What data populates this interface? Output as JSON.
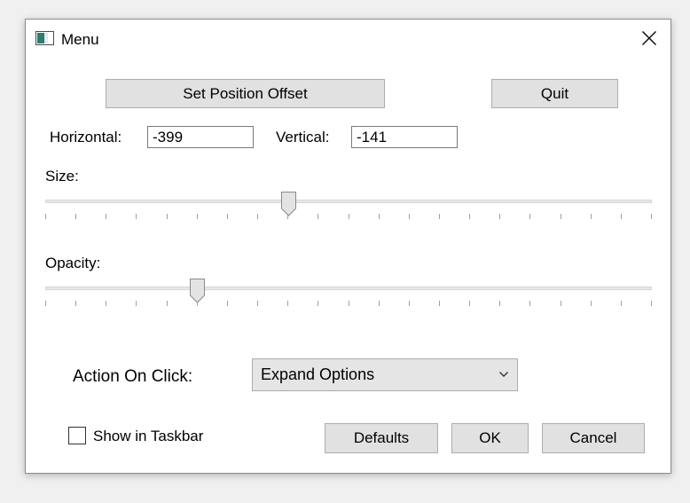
{
  "window": {
    "title": "Menu"
  },
  "position": {
    "set_offset_label": "Set Position Offset",
    "quit_label": "Quit",
    "horizontal_label": "Horizontal:",
    "horizontal_value": "-399",
    "vertical_label": "Vertical:",
    "vertical_value": "-141"
  },
  "size": {
    "label": "Size:",
    "value_fraction": 0.4,
    "tick_count": 21
  },
  "opacity": {
    "label": "Opacity:",
    "value_fraction": 0.25,
    "tick_count": 21
  },
  "action": {
    "label": "Action On Click:",
    "selected": "Expand Options"
  },
  "taskbar": {
    "label": "Show in Taskbar",
    "checked": false
  },
  "buttons": {
    "defaults": "Defaults",
    "ok": "OK",
    "cancel": "Cancel"
  },
  "icons": {
    "app": "app-icon",
    "close": "close-icon",
    "dropdown": "chevron-down-icon"
  }
}
